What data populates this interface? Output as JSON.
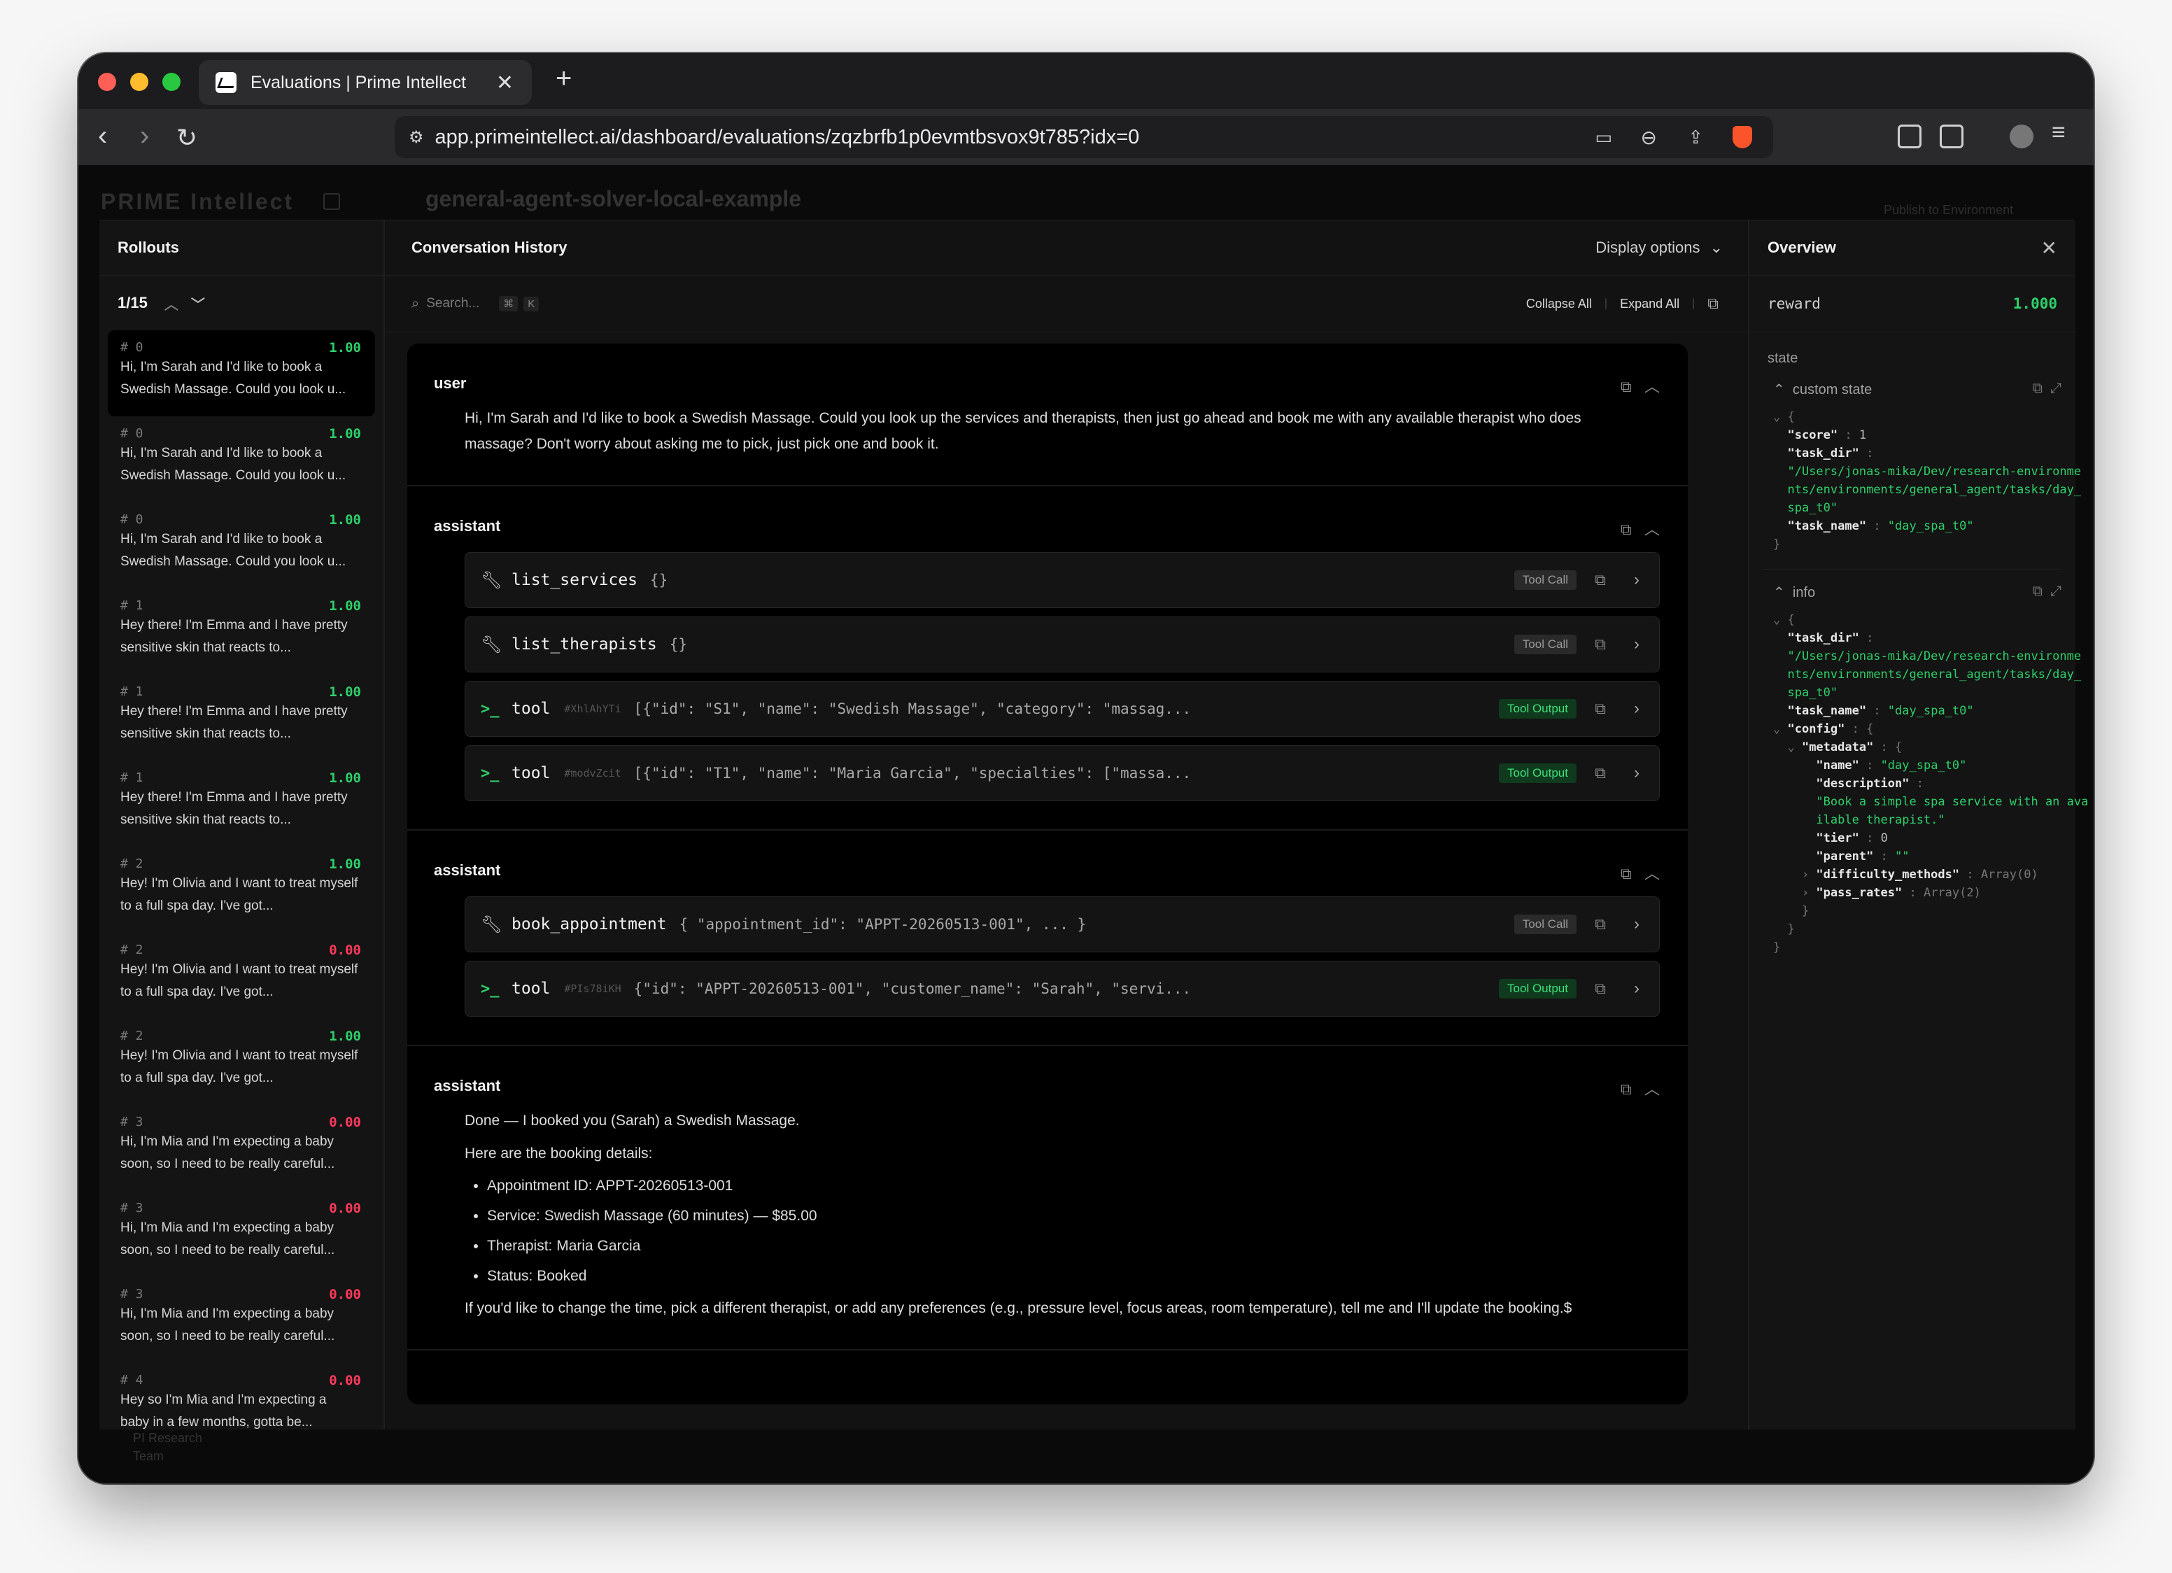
{
  "browser": {
    "tab_title": "Evaluations | Prime Intellect",
    "url": "app.primeintellect.ai/dashboard/evaluations/zqzbrfb1p0evmtbsvox9t785?idx=0"
  },
  "background": {
    "logo": "PRIME Intellect",
    "env_title": "general-agent-solver-local-example",
    "publish": "Publish to Environment",
    "team_name": "PI Research",
    "team_sub": "Team"
  },
  "rollouts": {
    "title": "Rollouts",
    "pager": "1/15",
    "items": [
      {
        "num": "# 0",
        "score": "1.00",
        "text": "Hi, I'm Sarah and I'd like to book a Swedish Massage. Could you look u..."
      },
      {
        "num": "# 0",
        "score": "1.00",
        "text": "Hi, I'm Sarah and I'd like to book a Swedish Massage. Could you look u..."
      },
      {
        "num": "# 0",
        "score": "1.00",
        "text": "Hi, I'm Sarah and I'd like to book a Swedish Massage. Could you look u..."
      },
      {
        "num": "# 1",
        "score": "1.00",
        "text": "Hey there! I'm Emma and I have pretty sensitive skin that reacts to..."
      },
      {
        "num": "# 1",
        "score": "1.00",
        "text": "Hey there! I'm Emma and I have pretty sensitive skin that reacts to..."
      },
      {
        "num": "# 1",
        "score": "1.00",
        "text": "Hey there! I'm Emma and I have pretty sensitive skin that reacts to..."
      },
      {
        "num": "# 2",
        "score": "1.00",
        "text": "Hey! I'm Olivia and I want to treat myself to a full spa day. I've got..."
      },
      {
        "num": "# 2",
        "score": "0.00",
        "text": "Hey! I'm Olivia and I want to treat myself to a full spa day. I've got..."
      },
      {
        "num": "# 2",
        "score": "1.00",
        "text": "Hey! I'm Olivia and I want to treat myself to a full spa day. I've got..."
      },
      {
        "num": "# 3",
        "score": "0.00",
        "text": "Hi, I'm Mia and I'm expecting a baby soon, so I need to be really careful..."
      },
      {
        "num": "# 3",
        "score": "0.00",
        "text": "Hi, I'm Mia and I'm expecting a baby soon, so I need to be really careful..."
      },
      {
        "num": "# 3",
        "score": "0.00",
        "text": "Hi, I'm Mia and I'm expecting a baby soon, so I need to be really careful..."
      },
      {
        "num": "# 4",
        "score": "0.00",
        "text": "Hey so I'm Mia and I'm expecting a baby in a few months, gotta be..."
      }
    ]
  },
  "conversation": {
    "title": "Conversation History",
    "display_options": "Display options",
    "search_placeholder": "Search...",
    "kbd_cmd": "⌘",
    "kbd_k": "K",
    "collapse_all": "Collapse All",
    "expand_all": "Expand All",
    "user": {
      "role": "user",
      "content": "Hi, I'm Sarah and I'd like to book a Swedish Massage. Could you look up the services and therapists, then just go ahead and book me with any available therapist who does massage? Don't worry about asking me to pick, just pick one and book it."
    },
    "assistant1": {
      "role": "assistant",
      "items": [
        {
          "kind": "call",
          "name": "list_services",
          "id": "",
          "args": "{}",
          "badge": "Tool Call"
        },
        {
          "kind": "call",
          "name": "list_therapists",
          "id": "",
          "args": "{}",
          "badge": "Tool Call"
        },
        {
          "kind": "out",
          "name": "tool",
          "id": "#XhlAhYTi",
          "args": "[{\"id\": \"S1\", \"name\": \"Swedish Massage\", \"category\": \"massag...",
          "badge": "Tool Output"
        },
        {
          "kind": "out",
          "name": "tool",
          "id": "#modvZcit",
          "args": "[{\"id\": \"T1\", \"name\": \"Maria Garcia\", \"specialties\": [\"massa...",
          "badge": "Tool Output"
        }
      ]
    },
    "assistant2": {
      "role": "assistant",
      "items": [
        {
          "kind": "call",
          "name": "book_appointment",
          "id": "",
          "args": "{ \"appointment_id\": \"APPT-20260513-001\", ... }",
          "badge": "Tool Call"
        },
        {
          "kind": "out",
          "name": "tool",
          "id": "#PIs78iKH",
          "args": "{\"id\": \"APPT-20260513-001\", \"customer_name\": \"Sarah\", \"servi...",
          "badge": "Tool Output"
        }
      ]
    },
    "assistant3": {
      "role": "assistant",
      "line1": "Done — I booked you (Sarah) a Swedish Massage.",
      "line2": "Here are the booking details:",
      "bullets": [
        "Appointment ID: APPT-20260513-001",
        "Service: Swedish Massage (60 minutes) — $85.00",
        "Therapist: Maria Garcia",
        "Status: Booked"
      ],
      "line3": "If you'd like to change the time, pick a different therapist, or add any preferences (e.g., pressure level, focus areas, room temperature), tell me and I'll update the booking.$"
    }
  },
  "overview": {
    "title": "Overview",
    "reward_key": "reward",
    "reward_value": "1.000",
    "state_label": "state",
    "custom_state_label": "custom state",
    "custom_state": {
      "score_key": "\"score\"",
      "score_val": "1",
      "task_dir_key": "\"task_dir\"",
      "task_dir_val_1": "\"/Users/jonas-mika/Dev/research-environme",
      "task_dir_val_2": "nts/environments/general_agent/tasks/day_",
      "task_dir_val_3": "spa_t0\"",
      "task_name_key": "\"task_name\"",
      "task_name_val": "\"day_spa_t0\""
    },
    "info_label": "info",
    "info": {
      "task_dir_key": "\"task_dir\"",
      "task_dir_val_1": "\"/Users/jonas-mika/Dev/research-environme",
      "task_dir_val_2": "nts/environments/general_agent/tasks/day_",
      "task_dir_val_3": "spa_t0\"",
      "task_name_key": "\"task_name\"",
      "task_name_val": "\"day_spa_t0\"",
      "config_key": "\"config\"",
      "metadata_key": "\"metadata\"",
      "name_key": "\"name\"",
      "name_val": "\"day_spa_t0\"",
      "description_key": "\"description\"",
      "description_val_1": "\"Book a simple spa service with an ava",
      "description_val_2": "ilable therapist.\"",
      "tier_key": "\"tier\"",
      "tier_val": "0",
      "parent_key": "\"parent\"",
      "parent_val": "\"\"",
      "difficulty_key": "\"difficulty_methods\"",
      "difficulty_val": "Array(0)",
      "pass_rates_key": "\"pass_rates\"",
      "pass_rates_val": "Array(2)"
    }
  },
  "colors": {
    "accent_green": "#2ed06a",
    "score_red": "#ff3b5c",
    "close_red": "#ff5f57",
    "min_yellow": "#febc2e",
    "max_green": "#28c840"
  }
}
